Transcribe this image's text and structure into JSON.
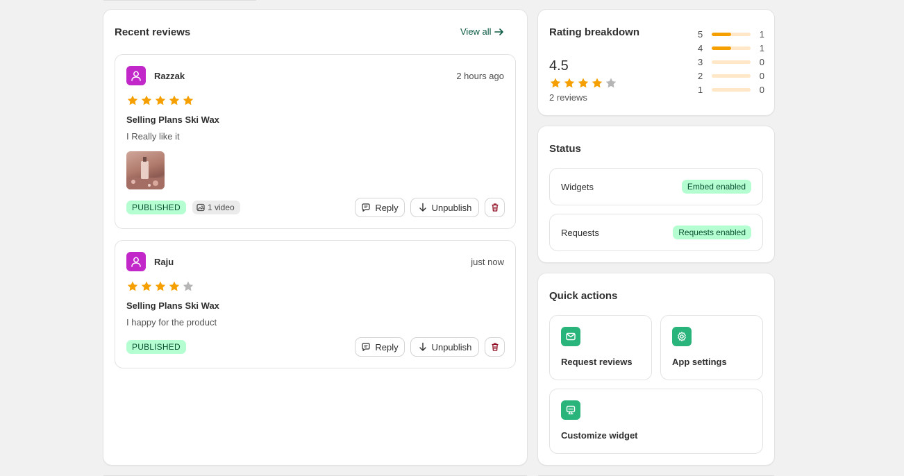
{
  "recent_reviews": {
    "title": "Recent reviews",
    "view_all": "View all",
    "reviews": [
      {
        "name": "Razzak",
        "time": "2 hours ago",
        "rating": 5,
        "product": "Selling Plans Ski Wax",
        "body": "I Really like it",
        "status": "PUBLISHED",
        "media": "1 video",
        "reply": "Reply",
        "unpublish": "Unpublish"
      },
      {
        "name": "Raju",
        "time": "just now",
        "rating": 4,
        "product": "Selling Plans Ski Wax",
        "body": "I happy for the product",
        "status": "PUBLISHED",
        "reply": "Reply",
        "unpublish": "Unpublish"
      }
    ]
  },
  "rating_breakdown": {
    "title": "Rating breakdown",
    "average": "4.5",
    "average_stars": 4,
    "count": "2 reviews",
    "rows": [
      {
        "stars": "5",
        "count": "1",
        "fill": 0.5
      },
      {
        "stars": "4",
        "count": "1",
        "fill": 0.5
      },
      {
        "stars": "3",
        "count": "0",
        "fill": 0
      },
      {
        "stars": "2",
        "count": "0",
        "fill": 0
      },
      {
        "stars": "1",
        "count": "0",
        "fill": 0
      }
    ]
  },
  "status": {
    "title": "Status",
    "items": [
      {
        "label": "Widgets",
        "badge": "Embed enabled"
      },
      {
        "label": "Requests",
        "badge": "Requests enabled"
      }
    ]
  },
  "quick_actions": {
    "title": "Quick actions",
    "items": [
      {
        "label": "Request reviews",
        "icon": "mail-icon"
      },
      {
        "label": "App settings",
        "icon": "gear-icon"
      },
      {
        "label": "Customize widget",
        "icon": "widget-icon"
      }
    ]
  },
  "colors": {
    "star_on": "#f5a000",
    "star_off": "#b5b5b5",
    "avatar": "#c127c9",
    "accent_green": "#29b47b",
    "badge_green": "#b4fed2",
    "link": "#0c5a44",
    "danger": "#8e0b21"
  }
}
